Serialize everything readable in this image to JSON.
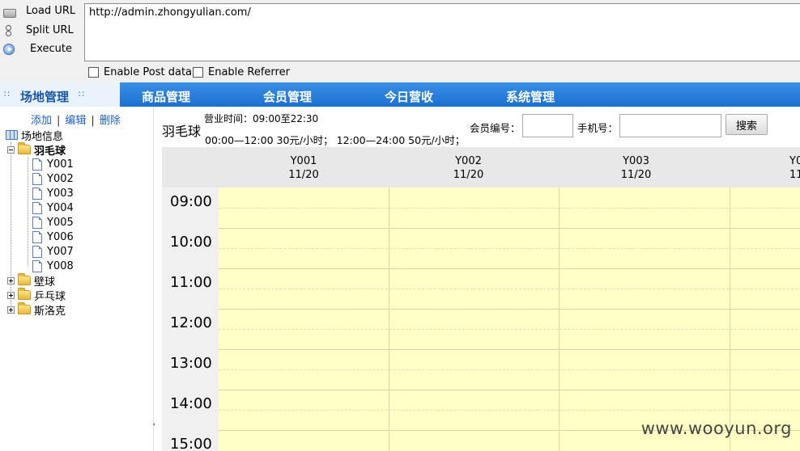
{
  "hackbar": {
    "load_url": "Load URL",
    "split_url": "Split URL",
    "execute": "Execute",
    "url": "http://admin.zhongyulian.com/",
    "enable_post": "Enable Post data",
    "enable_referrer": "Enable Referrer"
  },
  "nav": {
    "active": "场地管理",
    "items": [
      "商品管理",
      "会员管理",
      "今日营收",
      "系统管理"
    ]
  },
  "tree": {
    "actions": [
      "添加",
      "编辑",
      "删除"
    ],
    "root": "场地信息",
    "badminton": "羽毛球",
    "courts": [
      "Y001",
      "Y002",
      "Y003",
      "Y004",
      "Y005",
      "Y006",
      "Y007",
      "Y008"
    ],
    "squash": "壁球",
    "pingpong": "乒乓球",
    "snooker": "斯洛克"
  },
  "venue": {
    "title": "羽毛球",
    "hours": "营业时间：09:00至22:30",
    "price": "00:00—12:00 30元/小时；  12:00—24:00 50元/小时；"
  },
  "search": {
    "member_label": "会员编号：",
    "phone_label": "手机号：",
    "button": "搜索"
  },
  "schedule": {
    "columns": [
      {
        "court": "Y001",
        "date": "11/20"
      },
      {
        "court": "Y002",
        "date": "11/20"
      },
      {
        "court": "Y003",
        "date": "11/20"
      },
      {
        "court": "Y0",
        "date": "11"
      }
    ],
    "times": [
      "09:00",
      "10:00",
      "11:00",
      "12:00",
      "13:00",
      "14:00",
      "15:00"
    ]
  },
  "watermark": "www.wooyun.org"
}
